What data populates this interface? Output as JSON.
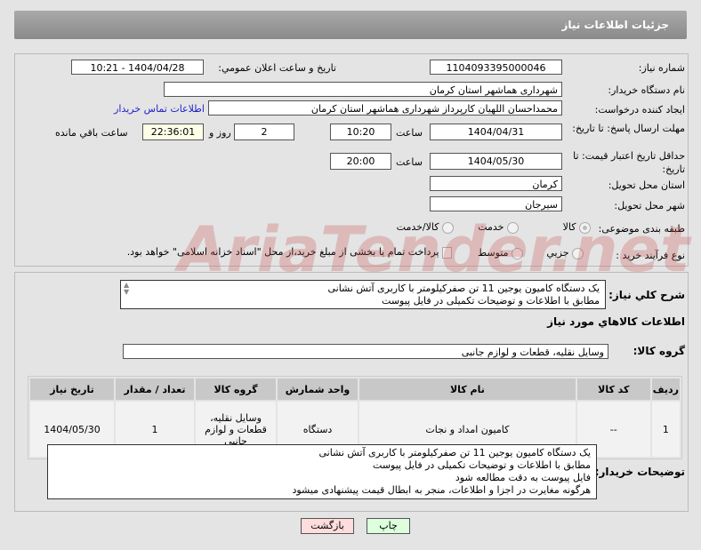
{
  "header": {
    "title": "جزئیات اطلاعات نیاز"
  },
  "fields": {
    "need_number_label": "شماره نیاز:",
    "need_number": "1104093395000046",
    "announce_label": "تاریخ و ساعت اعلان عمومي:",
    "announce_value": "1404/04/28 - 10:21",
    "buyer_org_label": "نام دستگاه خریدار:",
    "buyer_org": "شهرداری هماشهر استان کرمان",
    "creator_label": "ایجاد کننده درخواست:",
    "creator": "محمداحسان اللهیان کارپرداز  شهرداری هماشهر استان کرمان",
    "contact_link": "اطلاعات تماس خریدار",
    "deadline_label": "مهلت ارسال پاسخ: تا تاریخ:",
    "deadline_date": "1404/04/31",
    "time_label": "ساعت",
    "deadline_time": "10:20",
    "days": "2",
    "days_label": "روز و",
    "remaining": "22:36:01",
    "remaining_label": "ساعت باقي مانده",
    "validity_label": "حداقل تاریخ اعتبار قیمت: تا تاریخ:",
    "validity_date": "1404/05/30",
    "validity_time": "20:00",
    "province_label": "استان محل تحویل:",
    "province": "کرمان",
    "city_label": "شهر محل تحویل:",
    "city": "سیرجان",
    "category_label": "طبقه بندی موضوعی:",
    "category_options": [
      "کالا",
      "خدمت",
      "کالا/خدمت"
    ],
    "process_label": "نوع فرآیند خرید :",
    "process_options": [
      "جزیي",
      "متوسط"
    ],
    "treasury_text": "پرداخت تمام یا بخشی از مبلغ خرید،از محل \"اسناد خزانه اسلامی\" خواهد بود."
  },
  "summary": {
    "label": "شرح کلي نیاز:",
    "lines": [
      "یک دستگاه کامیون یوجین 11 تن صفرکیلومتر با کاربری آتش نشانی",
      "مطابق با اطلاعات و توضیحات تکمیلی در فایل پیوست"
    ]
  },
  "goods": {
    "heading": "اطلاعات کالاهاي مورد نیاز",
    "group_label": "گروه کالا:",
    "group_value": "وسایل نقلیه، قطعات و لوازم جانبی",
    "columns": [
      "ردیف",
      "کد کالا",
      "نام کالا",
      "واحد شمارش",
      "گروه کالا",
      "تعداد / مقدار",
      "تاریخ نیاز"
    ],
    "rows": [
      [
        "1",
        "--",
        "کامیون امداد و نجات",
        "دستگاه",
        "وسایل نقلیه، قطعات و لوازم جانبی",
        "1",
        "1404/05/30"
      ]
    ]
  },
  "notes": {
    "label": "توضیحات خریدار:",
    "lines": [
      "یک دستگاه کامیون یوجین 11 تن صفرکیلومتر با کاربری آتش نشانی",
      "مطابق با اطلاعات و توضیحات تکمیلی در فایل پیوست",
      "فایل پیوست به دقت مطالعه شود",
      "هرگونه مغایرت در اجزا و اطلاعات، منجر به ابطال قیمت پیشنهادی میشود"
    ]
  },
  "buttons": {
    "back": "بازگشت",
    "print": "چاپ"
  },
  "watermark": "AriaTender.net"
}
